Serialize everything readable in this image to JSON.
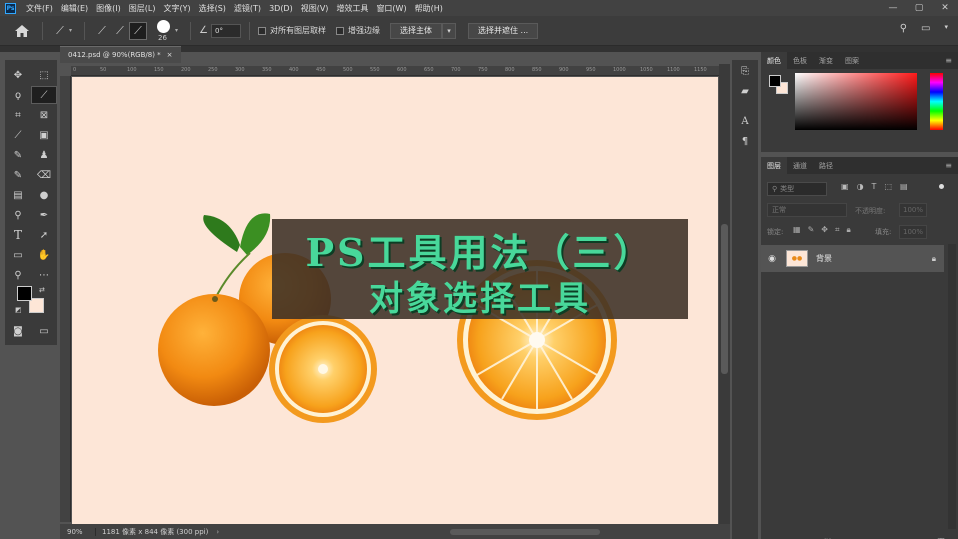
{
  "menubar": {
    "logo": "Ps",
    "items": [
      "文件(F)",
      "编辑(E)",
      "图像(I)",
      "图层(L)",
      "文字(Y)",
      "选择(S)",
      "滤镜(T)",
      "3D(D)",
      "视图(V)",
      "增效工具",
      "窗口(W)",
      "帮助(H)"
    ],
    "window_controls": [
      "—",
      "▢",
      "✕"
    ]
  },
  "options": {
    "brush_size": "26",
    "angle": "0°",
    "sample_all_layers": "对所有图层取样",
    "enhance_edge": "增强边缘",
    "select_subject": "选择主体",
    "select_and_mask": "选择并遮住 ..."
  },
  "document": {
    "tab_title": "0412.psd @ 90%(RGB/8) *",
    "ruler_ticks": [
      "0",
      "50",
      "100",
      "150",
      "200",
      "250",
      "300",
      "350",
      "400",
      "450",
      "500",
      "550",
      "600",
      "650",
      "700",
      "750",
      "800",
      "850",
      "900",
      "950",
      "1000",
      "1050",
      "1100",
      "1150"
    ],
    "canvas_title_line1": "PS工具用法（三）",
    "canvas_title_line2": "对象选择工具",
    "zoom": "90%",
    "dimensions": "1181 像素 x 844 像素 (300 ppi)"
  },
  "colors": {
    "foreground": "#000000",
    "background": "#fde6d7",
    "title_text": "#48d89a",
    "canvas_bg": "#fde6d7",
    "orange": "#f08a14"
  },
  "color_panel": {
    "tabs": [
      "颜色",
      "色板",
      "渐变",
      "图案"
    ]
  },
  "layers_panel": {
    "tabs": [
      "图层",
      "通道",
      "路径"
    ],
    "search_placeholder": "类型",
    "blend_mode": "正常",
    "opacity_label": "不透明度:",
    "opacity_value": "100%",
    "lock_label": "锁定:",
    "fill_label": "填充:",
    "fill_value": "100%",
    "layers": [
      {
        "name": "背景",
        "visible": true,
        "locked": true
      }
    ]
  }
}
